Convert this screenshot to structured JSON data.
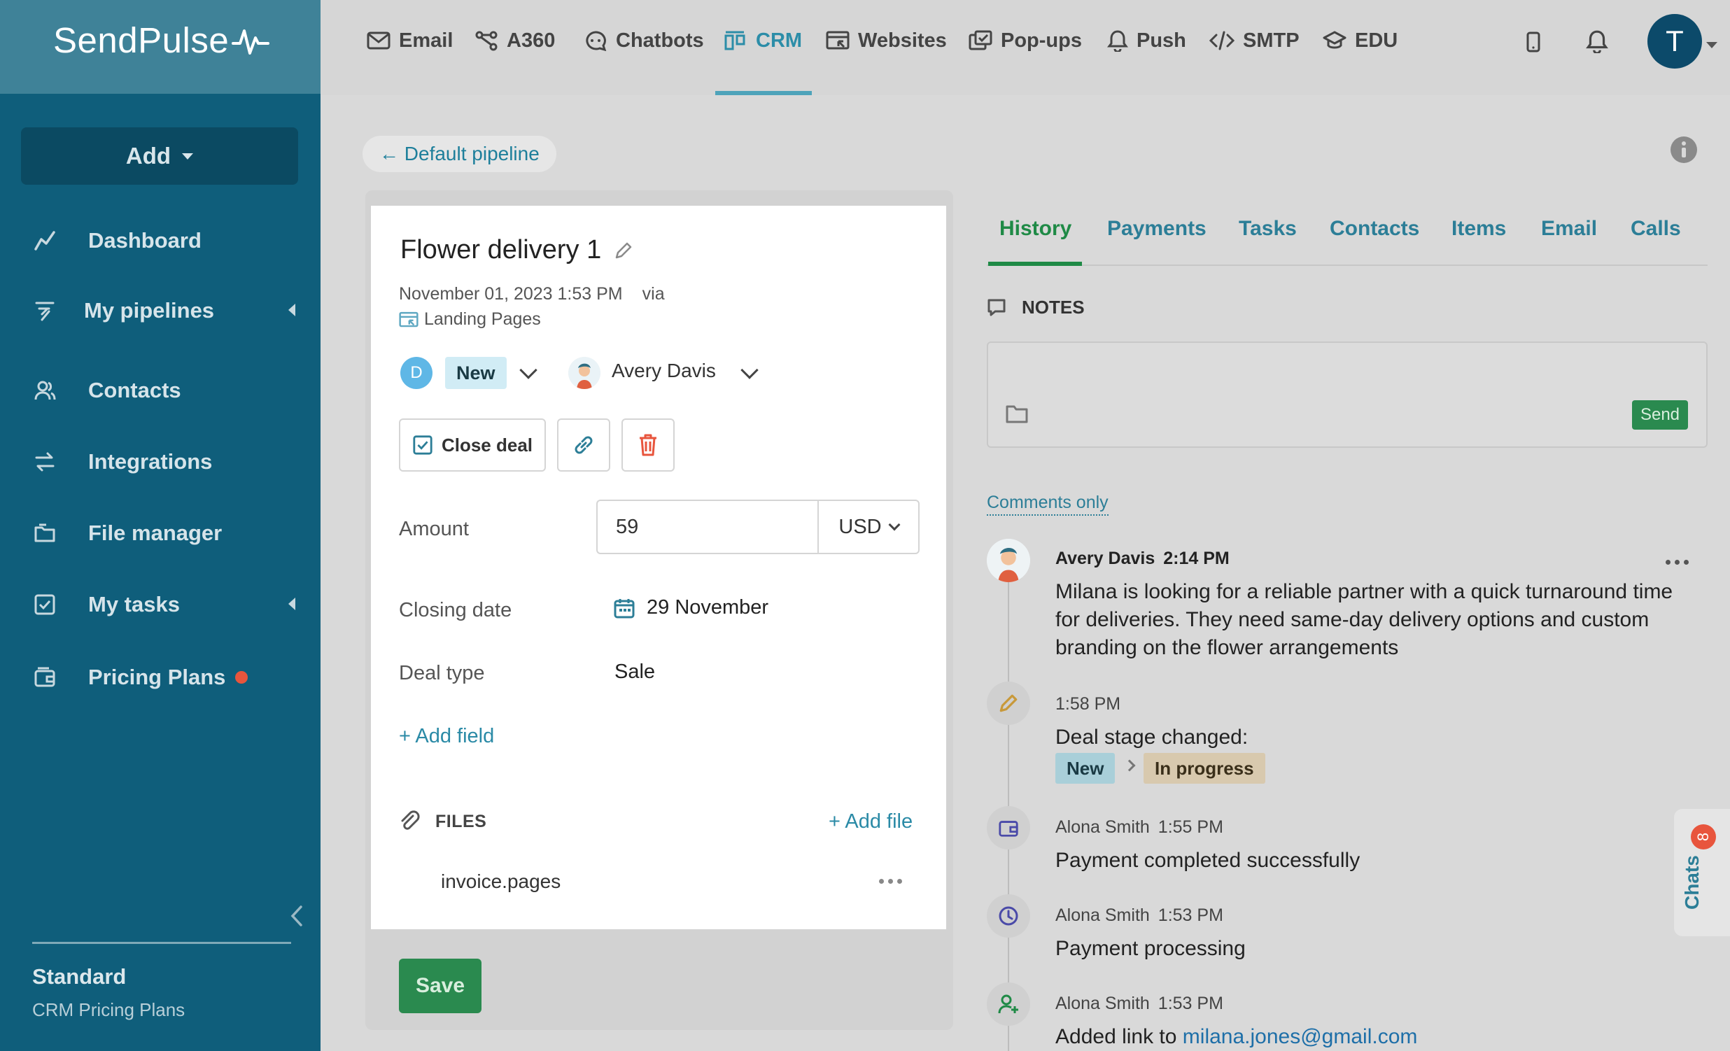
{
  "brand": {
    "name": "SendPulse"
  },
  "sidebar": {
    "add_label": "Add",
    "items": [
      {
        "label": "Dashboard",
        "icon": "chart-line-icon"
      },
      {
        "label": "My pipelines",
        "icon": "funnel-icon"
      },
      {
        "label": "Contacts",
        "icon": "users-icon"
      },
      {
        "label": "Integrations",
        "icon": "arrows-icon"
      },
      {
        "label": "File manager",
        "icon": "folder-icon"
      },
      {
        "label": "My tasks",
        "icon": "checkbox-icon"
      },
      {
        "label": "Pricing Plans",
        "icon": "wallet-icon"
      }
    ],
    "plan": {
      "name": "Standard",
      "sub": "CRM Pricing Plans"
    }
  },
  "topnav": {
    "items": [
      {
        "label": "Email",
        "icon": "envelope-icon"
      },
      {
        "label": "A360",
        "icon": "automation-icon"
      },
      {
        "label": "Chatbots",
        "icon": "chat-icon"
      },
      {
        "label": "CRM",
        "icon": "crm-icon",
        "active": true
      },
      {
        "label": "Websites",
        "icon": "website-icon"
      },
      {
        "label": "Pop-ups",
        "icon": "popup-icon"
      },
      {
        "label": "Push",
        "icon": "bell-icon"
      },
      {
        "label": "SMTP",
        "icon": "code-icon"
      },
      {
        "label": "EDU",
        "icon": "graduation-icon"
      }
    ],
    "avatar_letter": "T"
  },
  "breadcrumb": {
    "label": "← Default pipeline"
  },
  "deal": {
    "title": "Flower delivery 1",
    "date": "November 01, 2023 1:53 PM",
    "via": "via",
    "source": "Landing Pages",
    "stage_initial": "D",
    "stage": "New",
    "owner": "Avery Davis",
    "close_label": "Close deal",
    "amount_label": "Amount",
    "amount": "59",
    "currency": "USD",
    "closing_label": "Closing date",
    "closing_value": "29 November",
    "type_label": "Deal type",
    "type_value": "Sale",
    "add_field": "+ Add field",
    "files_label": "FILES",
    "add_file": "+ Add file",
    "file_name": "invoice.pages",
    "save_label": "Save"
  },
  "tabs": [
    "History",
    "Payments",
    "Tasks",
    "Contacts",
    "Items",
    "Email",
    "Calls"
  ],
  "notes": {
    "label": "NOTES",
    "send": "Send",
    "filter": "Comments only"
  },
  "history": [
    {
      "author": "Avery Davis",
      "time": "2:14 PM",
      "text": "Milana is looking for a reliable partner with a quick turnaround time for deliveries. They need same-day delivery options and custom branding on the flower arrangements"
    },
    {
      "time": "1:58 PM",
      "text": "Deal stage changed:",
      "from": "New",
      "to": "In progress"
    },
    {
      "author": "Alona Smith",
      "time": "1:55 PM",
      "text": "Payment completed successfully"
    },
    {
      "author": "Alona Smith",
      "time": "1:53 PM",
      "text": "Payment processing"
    },
    {
      "author": "Alona Smith",
      "time": "1:53 PM",
      "text": "Added link to",
      "link": "milana.jones@gmail.com"
    }
  ],
  "chats": {
    "label": "Chats",
    "count": "8"
  },
  "colors": {
    "sidebar": "#0f5e7b",
    "accent": "#2c8da8",
    "green": "#2a8a4f",
    "red": "#e8553d"
  }
}
